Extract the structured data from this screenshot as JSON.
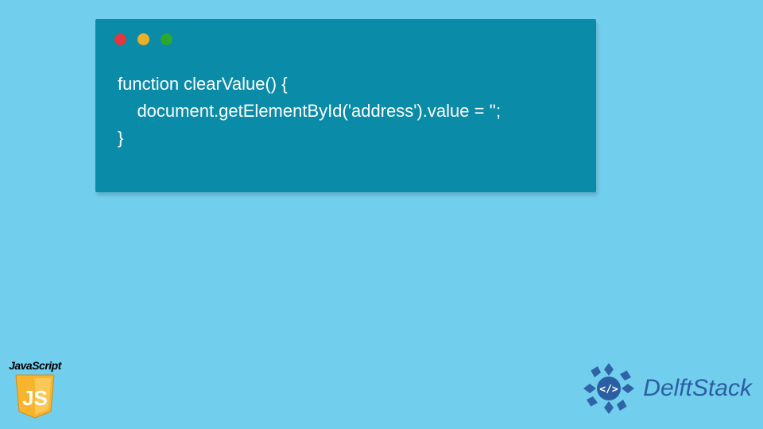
{
  "window": {
    "dots": [
      "red",
      "yellow",
      "green"
    ]
  },
  "code": {
    "line1": "function clearValue() {",
    "line2": "    document.getElementById('address').value = '';",
    "line3": "}"
  },
  "js_badge": {
    "label": "JavaScript",
    "shield_text": "JS",
    "shield_color": "#f7b42c"
  },
  "brand": {
    "name": "DelftStack",
    "logo_color": "#2b5fa3",
    "logo_glyph": "</>"
  }
}
